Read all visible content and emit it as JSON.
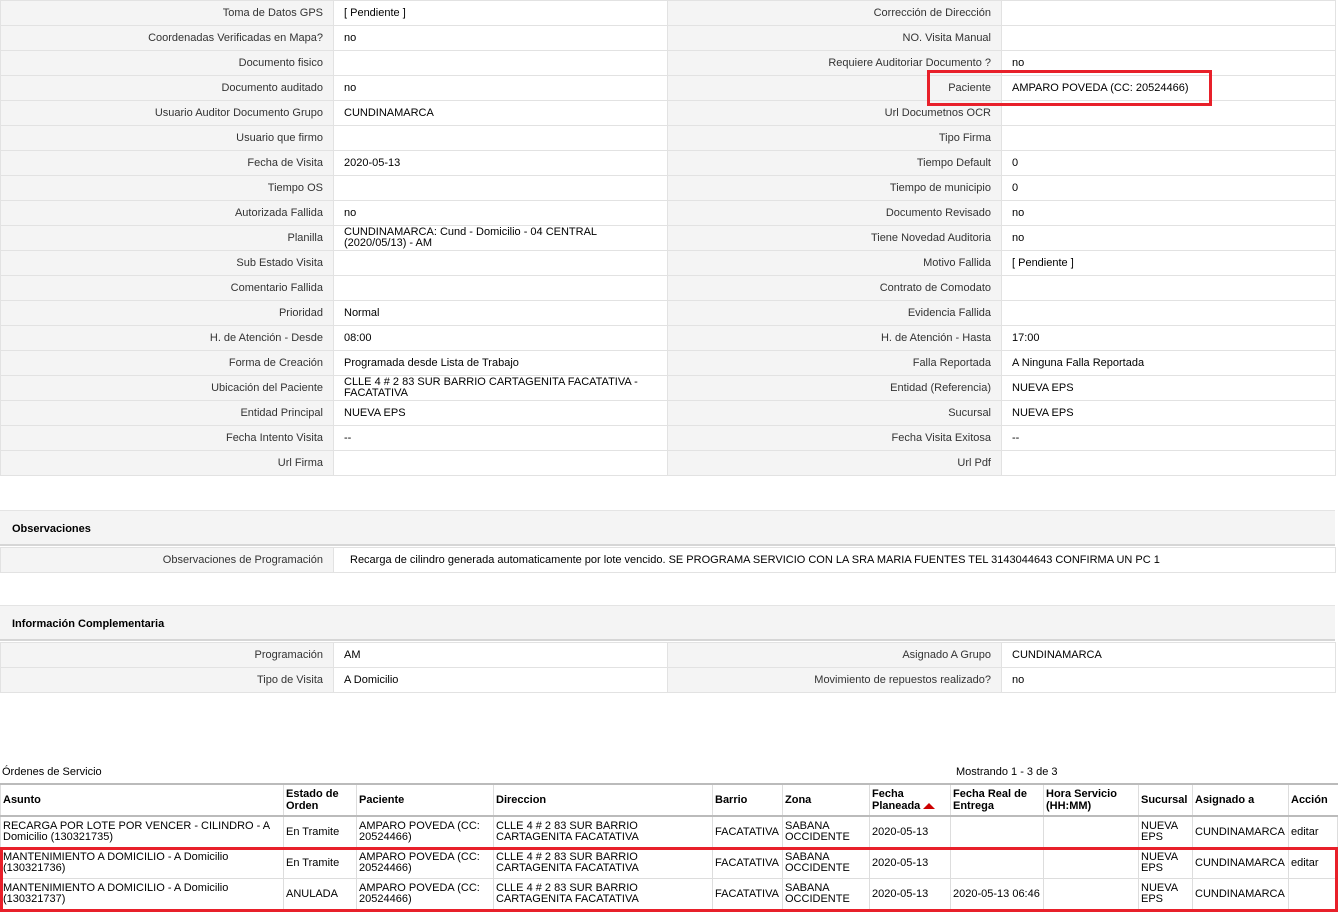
{
  "detail_rows": [
    {
      "l1": "Toma de Datos GPS",
      "v1": "[ Pendiente ]",
      "l2": "Corrección de Dirección",
      "v2": ""
    },
    {
      "l1": "Coordenadas Verificadas en Mapa?",
      "v1": "no",
      "l2": "NO. Visita Manual",
      "v2": ""
    },
    {
      "l1": "Documento fisico",
      "v1": "",
      "l2": "Requiere Auditoriar Documento ?",
      "v2": "no"
    },
    {
      "l1": "Documento auditado",
      "v1": "no",
      "l2": "Paciente",
      "v2": "AMPARO POVEDA (CC: 20524466)"
    },
    {
      "l1": "Usuario Auditor Documento Grupo",
      "v1": "CUNDINAMARCA",
      "l2": "Url Documetnos OCR",
      "v2": ""
    },
    {
      "l1": "Usuario que firmo",
      "v1": "",
      "l2": "Tipo Firma",
      "v2": ""
    },
    {
      "l1": "Fecha de Visita",
      "v1": "2020-05-13",
      "l2": "Tiempo Default",
      "v2": "0"
    },
    {
      "l1": "Tiempo OS",
      "v1": "",
      "l2": "Tiempo de municipio",
      "v2": "0"
    },
    {
      "l1": "Autorizada Fallida",
      "v1": "no",
      "l2": "Documento Revisado",
      "v2": "no"
    },
    {
      "l1": "Planilla",
      "v1": "CUNDINAMARCA: Cund - Domicilio - 04 CENTRAL (2020/05/13) - AM",
      "l2": "Tiene Novedad Auditoria",
      "v2": "no"
    },
    {
      "l1": "Sub Estado Visita",
      "v1": "",
      "l2": "Motivo Fallida",
      "v2": "[ Pendiente ]"
    },
    {
      "l1": "Comentario Fallida",
      "v1": "",
      "l2": "Contrato de Comodato",
      "v2": ""
    },
    {
      "l1": "Prioridad",
      "v1": "Normal",
      "l2": "Evidencia Fallida",
      "v2": ""
    },
    {
      "l1": "H. de Atención - Desde",
      "v1": "08:00",
      "l2": "H. de Atención - Hasta",
      "v2": "17:00"
    },
    {
      "l1": "Forma de Creación",
      "v1": "Programada desde Lista de Trabajo",
      "l2": "Falla Reportada",
      "v2": "A Ninguna Falla Reportada"
    },
    {
      "l1": "Ubicación del Paciente",
      "v1": "CLLE 4 # 2 83 SUR BARRIO CARTAGENITA FACATATIVA - FACATATIVA",
      "l2": "Entidad (Referencia)",
      "v2": "NUEVA EPS"
    },
    {
      "l1": "Entidad Principal",
      "v1": "NUEVA EPS",
      "l2": "Sucursal",
      "v2": "NUEVA EPS"
    },
    {
      "l1": "Fecha Intento Visita",
      "v1": "--",
      "l2": "Fecha Visita Exitosa",
      "v2": "--"
    },
    {
      "l1": "Url Firma",
      "v1": "",
      "l2": "Url Pdf",
      "v2": ""
    }
  ],
  "observaciones": {
    "title": "Observaciones",
    "label": "Observaciones de Programación",
    "value": "Recarga de cilindro generada automaticamente por lote vencido. SE PROGRAMA SERVICIO CON LA SRA MARIA FUENTES TEL 3143044643 CONFIRMA UN PC 1"
  },
  "complementaria": {
    "title": "Información Complementaria",
    "rows": [
      {
        "l1": "Programación",
        "v1": "AM",
        "l2": "Asignado A Grupo",
        "v2": "CUNDINAMARCA"
      },
      {
        "l1": "Tipo de Visita",
        "v1": "A Domicilio",
        "l2": "Movimiento de repuestos realizado?",
        "v2": "no"
      }
    ]
  },
  "orders": {
    "title": "Órdenes de Servicio",
    "count_text": "Mostrando 1 - 3 de 3",
    "columns": [
      "Asunto",
      "Estado de Orden",
      "Paciente",
      "Direccion",
      "Barrio",
      "Zona",
      "Fecha Planeada",
      "Fecha Real de Entrega",
      "Hora Servicio (HH:MM)",
      "Sucursal",
      "Asignado a",
      "Acción"
    ],
    "rows": [
      [
        "RECARGA POR LOTE POR VENCER - CILINDRO - A Domicilio (130321735)",
        "En Tramite",
        "AMPARO POVEDA (CC: 20524466)",
        "CLLE 4 # 2 83 SUR BARRIO CARTAGENITA FACATATIVA",
        "FACATATIVA",
        "SABANA OCCIDENTE",
        "2020-05-13",
        "",
        "",
        "NUEVA EPS",
        "CUNDINAMARCA",
        "editar"
      ],
      [
        "MANTENIMIENTO A DOMICILIO - A Domicilio (130321736)",
        "En Tramite",
        "AMPARO POVEDA (CC: 20524466)",
        "CLLE 4 # 2 83 SUR BARRIO CARTAGENITA FACATATIVA",
        "FACATATIVA",
        "SABANA OCCIDENTE",
        "2020-05-13",
        "",
        "",
        "NUEVA EPS",
        "CUNDINAMARCA",
        "editar"
      ],
      [
        "MANTENIMIENTO A DOMICILIO - A Domicilio (130321737)",
        "ANULADA",
        "AMPARO POVEDA (CC: 20524466)",
        "CLLE 4 # 2 83 SUR BARRIO CARTAGENITA FACATATIVA",
        "FACATATIVA",
        "SABANA OCCIDENTE",
        "2020-05-13",
        "2020-05-13 06:46",
        "",
        "NUEVA EPS",
        "CUNDINAMARCA",
        ""
      ]
    ]
  },
  "colors": {
    "highlight": "#e8202a",
    "sort_arrow": "#cc0000"
  }
}
